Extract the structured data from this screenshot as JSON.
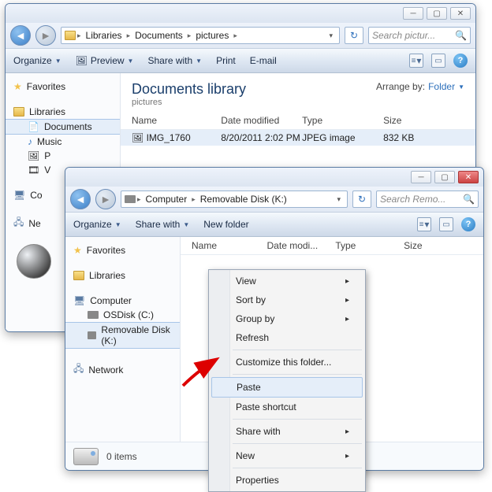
{
  "window1": {
    "breadcrumbs": [
      "Libraries",
      "Documents",
      "pictures"
    ],
    "search_placeholder": "Search pictur...",
    "toolbar": {
      "organize": "Organize",
      "preview": "Preview",
      "share": "Share with",
      "print": "Print",
      "email": "E-mail"
    },
    "sidebar": {
      "favorites": "Favorites",
      "libraries": "Libraries",
      "lib_items": [
        "Documents",
        "Music",
        "P",
        "V"
      ],
      "computer_short": "Co",
      "network_short": "Ne"
    },
    "library": {
      "title": "Documents library",
      "subtitle": "pictures",
      "arrange_label": "Arrange by:",
      "arrange_value": "Folder"
    },
    "columns": [
      "Name",
      "Date modified",
      "Type",
      "Size"
    ],
    "rows": [
      {
        "name": "IMG_1760",
        "date": "8/20/2011 2:02 PM",
        "type": "JPEG image",
        "size": "832 KB"
      }
    ]
  },
  "window2": {
    "breadcrumbs": [
      "Computer",
      "Removable Disk (K:)"
    ],
    "search_placeholder": "Search Remo...",
    "toolbar": {
      "organize": "Organize",
      "share": "Share with",
      "newfolder": "New folder"
    },
    "sidebar": {
      "favorites": "Favorites",
      "libraries": "Libraries",
      "computer": "Computer",
      "drives": [
        "OSDisk (C:)",
        "Removable Disk (K:)"
      ],
      "network": "Network"
    },
    "columns": [
      "Name",
      "Date modi...",
      "Type",
      "Size"
    ],
    "status": "0 items"
  },
  "context_menu": {
    "items": [
      {
        "label": "View",
        "submenu": true
      },
      {
        "label": "Sort by",
        "submenu": true
      },
      {
        "label": "Group by",
        "submenu": true
      },
      {
        "label": "Refresh"
      },
      {
        "sep": true
      },
      {
        "label": "Customize this folder..."
      },
      {
        "sep": true
      },
      {
        "label": "Paste",
        "highlight": true
      },
      {
        "label": "Paste shortcut"
      },
      {
        "sep": true
      },
      {
        "label": "Share with",
        "submenu": true
      },
      {
        "sep": true
      },
      {
        "label": "New",
        "submenu": true
      },
      {
        "sep": true
      },
      {
        "label": "Properties"
      }
    ]
  }
}
